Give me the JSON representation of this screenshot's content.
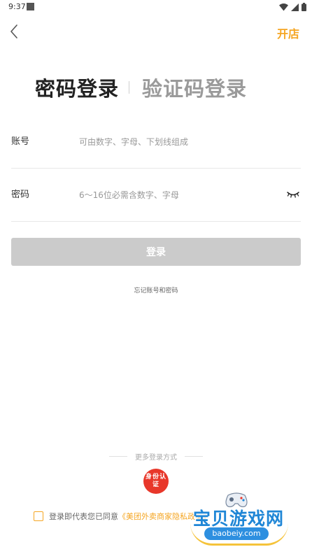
{
  "status_bar": {
    "time": "9:37"
  },
  "header": {
    "back_icon": "chevron-left-icon",
    "open_shop": "开店"
  },
  "tabs": {
    "active": "密码登录",
    "inactive": "验证码登录"
  },
  "form": {
    "account": {
      "label": "账号",
      "placeholder": "可由数字、字母、下划线组成"
    },
    "password": {
      "label": "密码",
      "placeholder": "6～16位必需含数字、字母",
      "toggle_icon": "eye-closed-icon"
    },
    "login_button": "登录",
    "forgot": "忘记账号和密码"
  },
  "more_login": {
    "label": "更多登录方式",
    "id_auth": "身份认证"
  },
  "agreement": {
    "prefix": "登录即代表您已同意",
    "link": "《美团外卖商家隐私政策》"
  },
  "watermark": {
    "title": "宝贝游戏网",
    "url": "baobeiy.com"
  },
  "colors": {
    "accent": "#f5a623",
    "button_disabled": "#cbcbcb",
    "id_auth": "#e8372a"
  }
}
